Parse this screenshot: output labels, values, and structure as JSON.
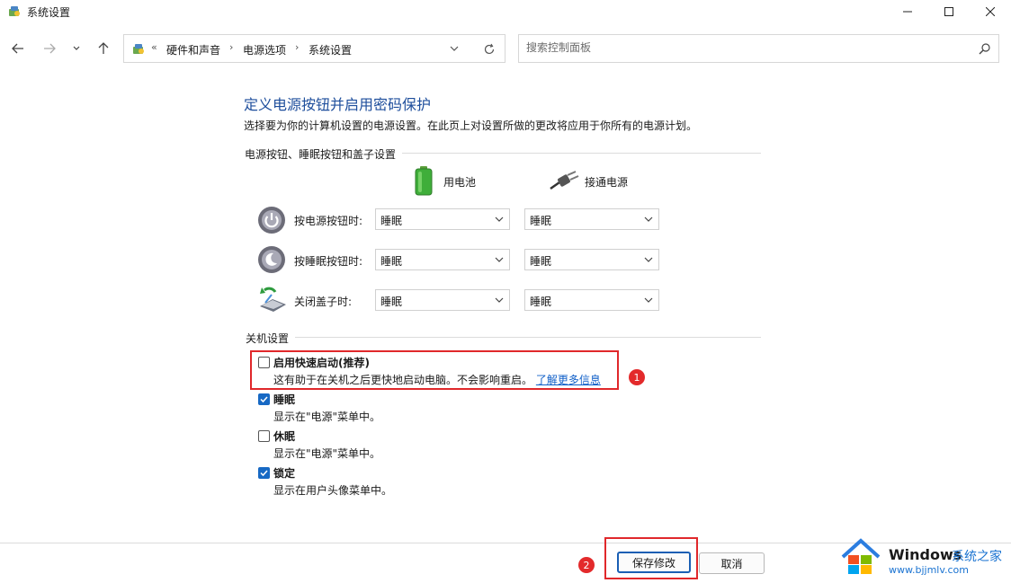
{
  "window": {
    "title": "系统设置"
  },
  "address": {
    "overflow": "«",
    "crumbs": [
      "硬件和声音",
      "电源选项",
      "系统设置"
    ],
    "sep": "›"
  },
  "search": {
    "placeholder": "搜索控制面板"
  },
  "main": {
    "title": "定义电源按钮并启用密码保护",
    "description": "选择要为你的计算机设置的电源设置。在此页上对设置所做的更改将应用于你所有的电源计划。",
    "buttons_section": {
      "label": "电源按钮、睡眠按钮和盖子设置",
      "col_battery": "用电池",
      "col_plugged": "接通电源",
      "rows": [
        {
          "label": "按电源按钮时:",
          "battery": "睡眠",
          "plugged": "睡眠"
        },
        {
          "label": "按睡眠按钮时:",
          "battery": "睡眠",
          "plugged": "睡眠"
        },
        {
          "label": "关闭盖子时:",
          "battery": "睡眠",
          "plugged": "睡眠"
        }
      ]
    },
    "shutdown_section": {
      "label": "关机设置",
      "options": [
        {
          "title": "启用快速启动(推荐)",
          "desc": "这有助于在关机之后更快地启动电脑。不会影响重启。",
          "link": "了解更多信息",
          "checked": false
        },
        {
          "title": "睡眠",
          "desc": "显示在\"电源\"菜单中。",
          "checked": true
        },
        {
          "title": "休眠",
          "desc": "显示在\"电源\"菜单中。",
          "checked": false
        },
        {
          "title": "锁定",
          "desc": "显示在用户头像菜单中。",
          "checked": true
        }
      ]
    }
  },
  "footer": {
    "save_label": "保存修改",
    "cancel_label": "取消"
  },
  "annotations": {
    "badge1": "1",
    "badge2": "2"
  },
  "watermark": {
    "brand": "Windows",
    "cn": "系统之家",
    "url": "www.bjjmlv.com"
  },
  "colors": {
    "accent": "#1769c4",
    "title_blue": "#1e4e9c",
    "annotation_red": "#e0282b",
    "link": "#1160c8"
  }
}
